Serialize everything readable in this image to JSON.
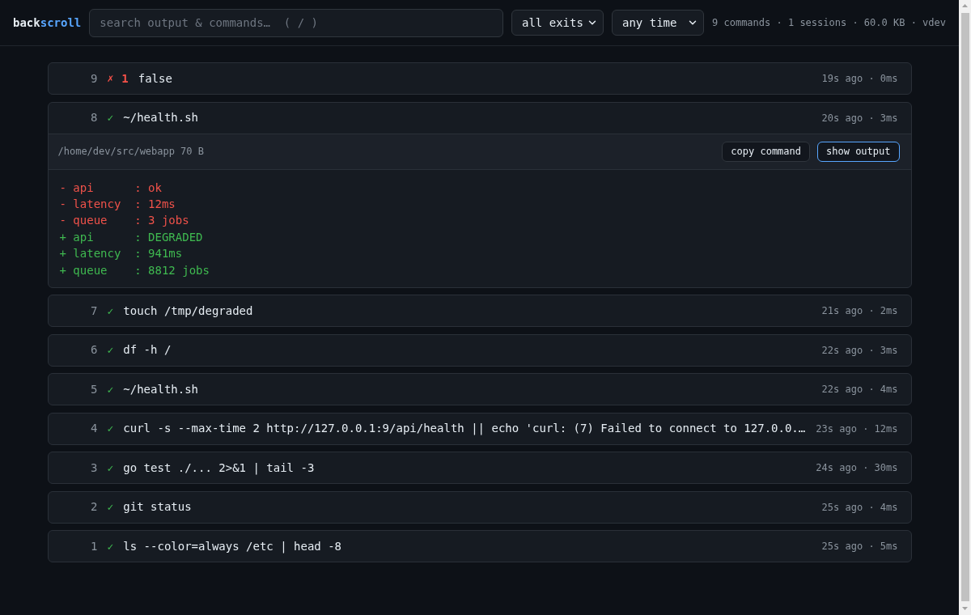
{
  "header": {
    "logo": {
      "primary": "back",
      "accent": "scroll"
    },
    "search": {
      "placeholder": "search output & commands…  ( / )"
    },
    "filters": [
      {
        "value": "all exits"
      },
      {
        "value": "any time"
      }
    ],
    "stats": "9 commands · 1 sessions · 60.0 KB · vdev"
  },
  "commands": [
    {
      "number": "9",
      "kind": "failed",
      "status_glyph": "✗",
      "exit_code": "1",
      "command": "false",
      "meta": "19s ago · 0ms",
      "expanded": false
    },
    {
      "number": "8",
      "kind": "ok",
      "status_glyph": "✓",
      "command": "~/health.sh",
      "meta": "20s ago · 3ms",
      "expanded": true,
      "details": {
        "cwd": "/home/dev/src/webapp",
        "size": "70 B",
        "buttons": [
          {
            "label": "copy command",
            "focused": false
          },
          {
            "label": "show output",
            "focused": true
          }
        ],
        "output": [
          {
            "kind": "removed",
            "text": "- api      : ok"
          },
          {
            "kind": "removed",
            "text": "- latency  : 12ms"
          },
          {
            "kind": "removed",
            "text": "- queue    : 3 jobs"
          },
          {
            "kind": "added",
            "text": "+ api      : DEGRADED"
          },
          {
            "kind": "added",
            "text": "+ latency  : 941ms"
          },
          {
            "kind": "added",
            "text": "+ queue    : 8812 jobs"
          }
        ]
      }
    },
    {
      "number": "7",
      "kind": "ok",
      "status_glyph": "✓",
      "command": "touch /tmp/degraded",
      "meta": "21s ago · 2ms",
      "expanded": false
    },
    {
      "number": "6",
      "kind": "ok",
      "status_glyph": "✓",
      "command": "df -h /",
      "meta": "22s ago · 3ms",
      "expanded": false
    },
    {
      "number": "5",
      "kind": "ok",
      "status_glyph": "✓",
      "command": "~/health.sh",
      "meta": "22s ago · 4ms",
      "expanded": false
    },
    {
      "number": "4",
      "kind": "ok",
      "status_glyph": "✓",
      "command": "curl -s --max-time 2 http://127.0.0.1:9/api/health || echo 'curl: (7) Failed to connect to 127.0.0.…",
      "meta": "23s ago · 12ms",
      "expanded": false
    },
    {
      "number": "3",
      "kind": "ok",
      "status_glyph": "✓",
      "command": "go test ./... 2>&1 | tail -3",
      "meta": "24s ago · 30ms",
      "expanded": false
    },
    {
      "number": "2",
      "kind": "ok",
      "status_glyph": "✓",
      "command": "git status",
      "meta": "25s ago · 4ms",
      "expanded": false
    },
    {
      "number": "1",
      "kind": "ok",
      "status_glyph": "✓",
      "command": "ls --color=always /etc | head -8",
      "meta": "25s ago · 5ms",
      "expanded": false
    }
  ]
}
